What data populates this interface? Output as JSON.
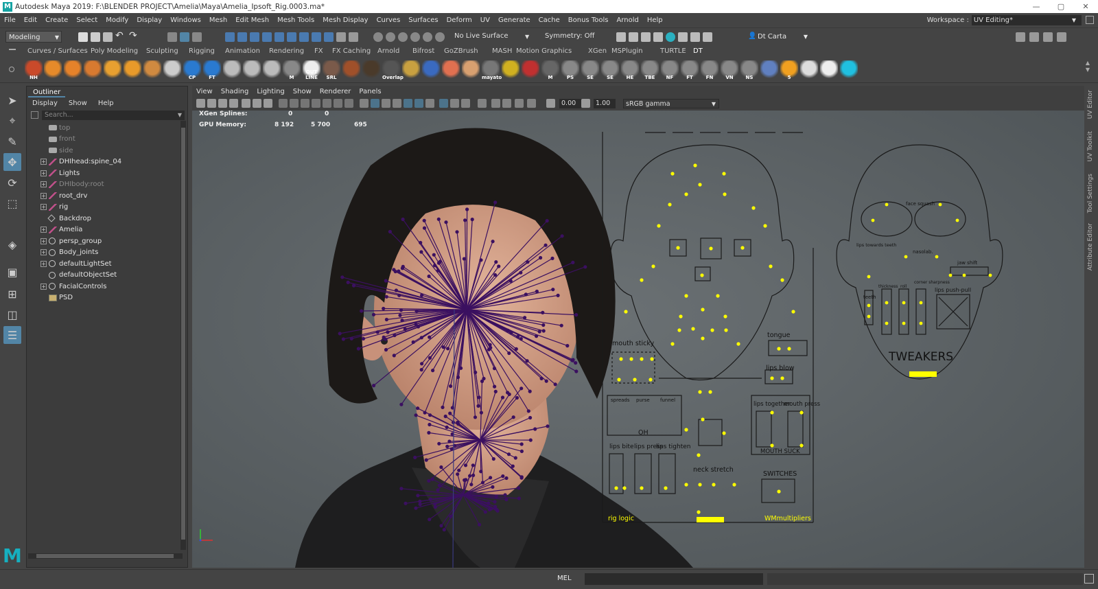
{
  "window": {
    "title": "Autodesk Maya 2019: F:\\BLENDER PROJECT\\Amelia\\Maya\\Amelia_Ipsoft_Rig.0003.ma*",
    "controls": [
      "—",
      "▢",
      "✕"
    ]
  },
  "menubar": {
    "items": [
      "File",
      "Edit",
      "Create",
      "Select",
      "Modify",
      "Display",
      "Windows",
      "Mesh",
      "Edit Mesh",
      "Mesh Tools",
      "Mesh Display",
      "Curves",
      "Surfaces",
      "Deform",
      "UV",
      "Generate",
      "Cache",
      "Bonus Tools",
      "Arnold",
      "Help"
    ],
    "workspace_label": "Workspace :",
    "workspace_value": "UV Editing*"
  },
  "statusline": {
    "menuset": "Modeling",
    "live_surface": "No Live Surface",
    "symmetry": "Symmetry: Off",
    "user": "Dt Carta"
  },
  "shelf": {
    "tabs": [
      "Curves / Surfaces",
      "Poly Modeling",
      "Sculpting",
      "Rigging",
      "Animation",
      "Rendering",
      "FX",
      "FX Caching",
      "Arnold",
      "Bifrost",
      "GoZBrush",
      "MASH",
      "Motion Graphics",
      "XGen",
      "MSPlugin",
      "TURTLE",
      "DT"
    ],
    "active_tab": "DT",
    "icons": [
      {
        "label": "NH",
        "color": "#c94a2a"
      },
      {
        "label": "",
        "color": "#e58a2a"
      },
      {
        "label": "",
        "color": "#e5822a"
      },
      {
        "label": "",
        "color": "#d87a30"
      },
      {
        "label": "",
        "color": "#e8a030"
      },
      {
        "label": "",
        "color": "#e89a2a"
      },
      {
        "label": "",
        "color": "#d08a40"
      },
      {
        "label": "",
        "color": "#ccc"
      },
      {
        "label": "CP",
        "color": "#2a7ad0"
      },
      {
        "label": "FT",
        "color": "#2a7ad0"
      },
      {
        "label": "",
        "color": "#bbb"
      },
      {
        "label": "",
        "color": "#bbb"
      },
      {
        "label": "",
        "color": "#bbb"
      },
      {
        "label": "M",
        "color": "#888"
      },
      {
        "label": "OUT LINE",
        "color": "#eee"
      },
      {
        "label": "SRL",
        "color": "#7a5a4a"
      },
      {
        "label": "",
        "color": "#a0502a"
      },
      {
        "label": "",
        "color": "#4a3a2a"
      },
      {
        "label": "Overlap",
        "color": "#555"
      },
      {
        "label": "",
        "color": "#c8a040"
      },
      {
        "label": "",
        "color": "#3a6ac0"
      },
      {
        "label": "",
        "color": "#e07050"
      },
      {
        "label": "",
        "color": "#d8a070"
      },
      {
        "label": "mayato",
        "color": "#777"
      },
      {
        "label": "",
        "color": "#d0b020"
      },
      {
        "label": "",
        "color": "#c03030"
      },
      {
        "label": "M",
        "color": "#666"
      },
      {
        "label": "PS",
        "color": "#888"
      },
      {
        "label": "SE",
        "color": "#888"
      },
      {
        "label": "SE",
        "color": "#888"
      },
      {
        "label": "HE",
        "color": "#888"
      },
      {
        "label": "TBE",
        "color": "#888"
      },
      {
        "label": "NF",
        "color": "#888"
      },
      {
        "label": "FT",
        "color": "#888"
      },
      {
        "label": "FN",
        "color": "#888"
      },
      {
        "label": "VN",
        "color": "#888"
      },
      {
        "label": "NS",
        "color": "#888"
      },
      {
        "label": "",
        "color": "#6080c0"
      },
      {
        "label": "5",
        "color": "#f0a020"
      },
      {
        "label": "",
        "color": "#ddd"
      },
      {
        "label": "",
        "color": "#eee"
      },
      {
        "label": "",
        "color": "#20c0e0"
      }
    ]
  },
  "outliner": {
    "tab": "Outliner",
    "menu": [
      "Display",
      "Show",
      "Help"
    ],
    "search_placeholder": "Search...",
    "items": [
      {
        "name": "top",
        "icon": "camera-icon",
        "expandable": false,
        "dim": true
      },
      {
        "name": "front",
        "icon": "camera-icon",
        "expandable": false,
        "dim": true
      },
      {
        "name": "side",
        "icon": "camera-icon",
        "expandable": false,
        "dim": true
      },
      {
        "name": "DHIhead:spine_04",
        "icon": "joint-icon",
        "expandable": true,
        "dim": false
      },
      {
        "name": "Lights",
        "icon": "joint-icon",
        "expandable": true,
        "dim": false
      },
      {
        "name": "DHIbody:root",
        "icon": "joint-icon",
        "expandable": true,
        "dim": true
      },
      {
        "name": "root_drv",
        "icon": "joint-icon",
        "expandable": true,
        "dim": false
      },
      {
        "name": "rig",
        "icon": "joint-icon",
        "expandable": true,
        "dim": false
      },
      {
        "name": "Backdrop",
        "icon": "transform-icon",
        "expandable": false,
        "dim": false
      },
      {
        "name": "Amelia",
        "icon": "joint-icon",
        "expandable": true,
        "dim": false
      },
      {
        "name": "persp_group",
        "icon": "set-icon",
        "expandable": true,
        "dim": false
      },
      {
        "name": "Body_joints",
        "icon": "set-icon",
        "expandable": true,
        "dim": false
      },
      {
        "name": "defaultLightSet",
        "icon": "set-icon",
        "expandable": true,
        "dim": false
      },
      {
        "name": "defaultObjectSet",
        "icon": "set-icon",
        "expandable": false,
        "dim": false
      },
      {
        "name": "FacialControls",
        "icon": "set-icon",
        "expandable": true,
        "dim": false
      },
      {
        "name": "PSD",
        "icon": "psd-icon",
        "expandable": false,
        "dim": false
      }
    ]
  },
  "viewport": {
    "menu": [
      "View",
      "Shading",
      "Lighting",
      "Show",
      "Renderer",
      "Panels"
    ],
    "exposure": "0.00",
    "gamma": "1.00",
    "color_space": "sRGB gamma",
    "hud": {
      "xgen_label": "XGen Splines:",
      "xgen_v1": "0",
      "xgen_v2": "0",
      "gpu_label": "GPU Memory:",
      "gpu_v1": "8 192",
      "gpu_v2": "5 700",
      "gpu_v3": "695"
    },
    "face_board": {
      "mouth_sticky": "mouth sticky",
      "tongue": "tongue",
      "lips_blow": "lips blow",
      "oh": "OH",
      "spreads": "spreads",
      "purse": "purse",
      "funnel": "funnel",
      "lips_bite": "lips bite",
      "lips_press": "lips press",
      "lips_tighten": "lips tighten",
      "lips_together": "lips together",
      "mouth_press": "mouth press",
      "mouth_suck": "MOUTH SUCK",
      "neck_stretch": "neck stretch",
      "switches": "SWITCHES",
      "rig_logic": "rig logic",
      "wm_multipliers": "WMmultipliers"
    },
    "tweakers": {
      "title": "TWEAKERS",
      "face_squash": "face squash",
      "lips_towards_teeth": "lips towards teeth",
      "nasolabial": "nasolab.",
      "jaw_shift": "jaw shift",
      "teeth": "teeth",
      "thickness": "thickness",
      "roll": "roll",
      "corner_sharpness": "corner sharpness",
      "lips_push_pull": "lips push-pull"
    },
    "accent_yellow": "#ffff00",
    "joint_purple": "#3b1060"
  },
  "side_tabs": [
    "UV Editor",
    "UV Toolkit",
    "Tool Settings",
    "Attribute Editor"
  ],
  "cmdline": {
    "lang": "MEL"
  }
}
